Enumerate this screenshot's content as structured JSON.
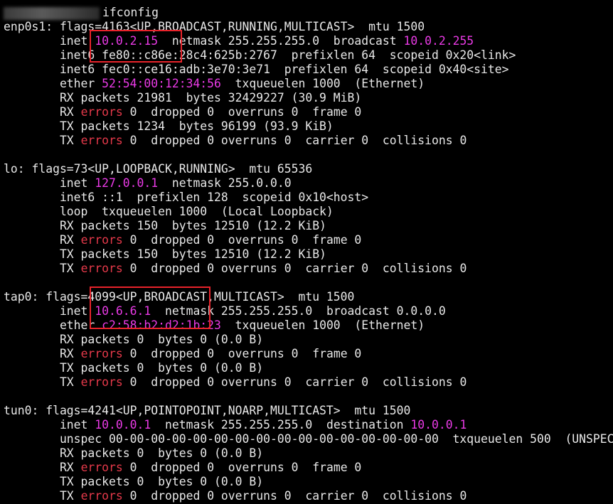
{
  "prompt": {
    "command": "ifconfig"
  },
  "colors": {
    "background": "#000000",
    "text": "#e8e8e8",
    "address_highlight": "#ea3ae6",
    "errors_highlight": "#e5394a",
    "annotation_box": "#e8232b"
  },
  "lines": [
    [
      {
        "t": "enp0s1: flags=4163<UP,BROADCAST,RUNNING,MULTICAST>  mtu 1500"
      }
    ],
    [
      {
        "t": "        inet "
      },
      {
        "t": "10.0.2.15",
        "c": "magenta"
      },
      {
        "t": "  netmask 255.255.255.0  broadcast "
      },
      {
        "t": "10.0.2.255",
        "c": "magenta"
      }
    ],
    [
      {
        "t": "        inet6 fe80::c86e:28c4:625b:2767  prefixlen 64  scopeid 0x20<link>"
      }
    ],
    [
      {
        "t": "        inet6 fec0::ce16:adb:3e70:3e71  prefixlen 64  scopeid 0x40<site>"
      }
    ],
    [
      {
        "t": "        ether "
      },
      {
        "t": "52:54:00:12:34:56",
        "c": "magenta"
      },
      {
        "t": "  txqueuelen 1000  (Ethernet)"
      }
    ],
    [
      {
        "t": "        RX packets 21981  bytes 32429227 (30.9 MiB)"
      }
    ],
    [
      {
        "t": "        RX "
      },
      {
        "t": "errors",
        "c": "red"
      },
      {
        "t": " 0  dropped 0  overruns 0  frame 0"
      }
    ],
    [
      {
        "t": "        TX packets 1234  bytes 96199 (93.9 KiB)"
      }
    ],
    [
      {
        "t": "        TX "
      },
      {
        "t": "errors",
        "c": "red"
      },
      {
        "t": " 0  dropped 0 overruns 0  carrier 0  collisions 0"
      }
    ],
    [
      {
        "t": ""
      }
    ],
    [
      {
        "t": "lo: flags=73<UP,LOOPBACK,RUNNING>  mtu 65536"
      }
    ],
    [
      {
        "t": "        inet "
      },
      {
        "t": "127.0.0.1",
        "c": "magenta"
      },
      {
        "t": "  netmask 255.0.0.0"
      }
    ],
    [
      {
        "t": "        inet6 ::1  prefixlen 128  scopeid 0x10<host>"
      }
    ],
    [
      {
        "t": "        loop  txqueuelen 1000  (Local Loopback)"
      }
    ],
    [
      {
        "t": "        RX packets 150  bytes 12510 (12.2 KiB)"
      }
    ],
    [
      {
        "t": "        RX "
      },
      {
        "t": "errors",
        "c": "red"
      },
      {
        "t": " 0  dropped 0  overruns 0  frame 0"
      }
    ],
    [
      {
        "t": "        TX packets 150  bytes 12510 (12.2 KiB)"
      }
    ],
    [
      {
        "t": "        TX "
      },
      {
        "t": "errors",
        "c": "red"
      },
      {
        "t": " 0  dropped 0 overruns 0  carrier 0  collisions 0"
      }
    ],
    [
      {
        "t": ""
      }
    ],
    [
      {
        "t": "tap0: flags=4099<UP,BROADCAST,MULTICAST>  mtu 1500"
      }
    ],
    [
      {
        "t": "        inet "
      },
      {
        "t": "10.6.6.1",
        "c": "magenta"
      },
      {
        "t": "  netmask 255.255.255.0  broadcast 0.0.0.0"
      }
    ],
    [
      {
        "t": "        ether "
      },
      {
        "t": "c2:58:b2:d2:1b:23",
        "c": "magenta"
      },
      {
        "t": "  txqueuelen 1000  (Ethernet)"
      }
    ],
    [
      {
        "t": "        RX packets 0  bytes 0 (0.0 B)"
      }
    ],
    [
      {
        "t": "        RX "
      },
      {
        "t": "errors",
        "c": "red"
      },
      {
        "t": " 0  dropped 0  overruns 0  frame 0"
      }
    ],
    [
      {
        "t": "        TX packets 0  bytes 0 (0.0 B)"
      }
    ],
    [
      {
        "t": "        TX "
      },
      {
        "t": "errors",
        "c": "red"
      },
      {
        "t": " 0  dropped 0 overruns 0  carrier 0  collisions 0"
      }
    ],
    [
      {
        "t": ""
      }
    ],
    [
      {
        "t": "tun0: flags=4241<UP,POINTOPOINT,NOARP,MULTICAST>  mtu 1500"
      }
    ],
    [
      {
        "t": "        inet "
      },
      {
        "t": "10.0.0.1",
        "c": "magenta"
      },
      {
        "t": "  netmask 255.255.255.0  destination "
      },
      {
        "t": "10.0.0.1",
        "c": "magenta"
      }
    ],
    [
      {
        "t": "        unspec 00-00-00-00-00-00-00-00-00-00-00-00-00-00-00-00  txqueuelen 500  (UNSPEC)"
      }
    ],
    [
      {
        "t": "        RX packets 0  bytes 0 (0.0 B)"
      }
    ],
    [
      {
        "t": "        RX "
      },
      {
        "t": "errors",
        "c": "red"
      },
      {
        "t": " 0  dropped 0  overruns 0  frame 0"
      }
    ],
    [
      {
        "t": "        TX packets 0  bytes 0 (0.0 B)"
      }
    ],
    [
      {
        "t": "        TX "
      },
      {
        "t": "errors",
        "c": "red"
      },
      {
        "t": " 0  dropped 0 overruns 0  carrier 0  collisions 0"
      }
    ]
  ]
}
